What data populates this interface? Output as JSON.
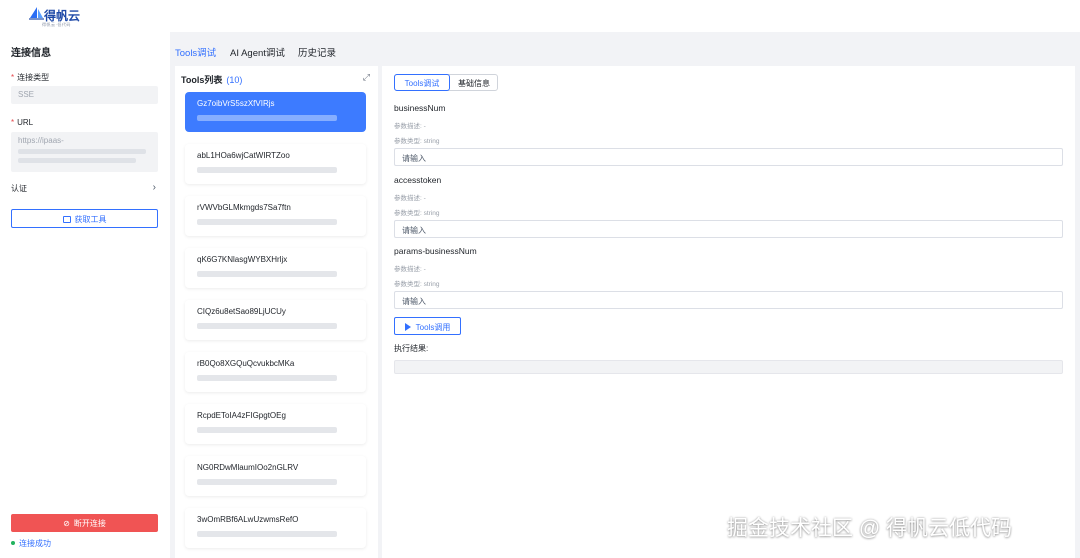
{
  "header": {
    "logo_text": "得帆云",
    "logo_sub": "得帆云·低代码"
  },
  "sidebar": {
    "title": "连接信息",
    "conn_type_label": "连接类型",
    "conn_type_value": "SSE",
    "url_label": "URL",
    "url_value": "https://ipaas-",
    "auth_label": "认证",
    "fetch_button": "获取工具",
    "disconnect_button": "断开连接",
    "status": "连接成功"
  },
  "tabs": [
    "Tools调试",
    "AI Agent调试",
    "历史记录"
  ],
  "tools": {
    "title": "Tools列表",
    "count": "(10)",
    "items": [
      {
        "name": "Gz7oibVrS5szXfVIRjs"
      },
      {
        "name": "abL1HOa6wjCatWIRTZoo"
      },
      {
        "name": "rVWVbGLMkmgds7Sa7ftn"
      },
      {
        "name": "qK6G7KNlasgWYBXHrljx"
      },
      {
        "name": "CIQz6u8etSao89LjUCUy"
      },
      {
        "name": "rB0Qo8XGQuQcvukbcMKa"
      },
      {
        "name": "RcpdEToIA4zFIGpgtOEg"
      },
      {
        "name": "NG0RDwMlaumIOo2nGLRV"
      },
      {
        "name": "3wOmRBf6ALwUzwmsRefO"
      }
    ]
  },
  "detail": {
    "tabs": [
      "Tools调试",
      "基础信息"
    ],
    "params": [
      {
        "name": "businessNum",
        "desc": "参数描述: -",
        "type": "参数类型: string",
        "placeholder": "请输入"
      },
      {
        "name": "accesstoken",
        "desc": "参数描述: -",
        "type": "参数类型: string",
        "placeholder": "请输入"
      },
      {
        "name": "params-businessNum",
        "desc": "参数描述: -",
        "type": "参数类型: string",
        "placeholder": "请输入"
      }
    ],
    "run_button": "Tools调用",
    "result_label": "执行结果:"
  },
  "watermark": "掘金技术社区 @ 得帆云低代码",
  "colors": {
    "accent": "#3370ff",
    "danger": "#f05454",
    "success": "#22b35e"
  }
}
